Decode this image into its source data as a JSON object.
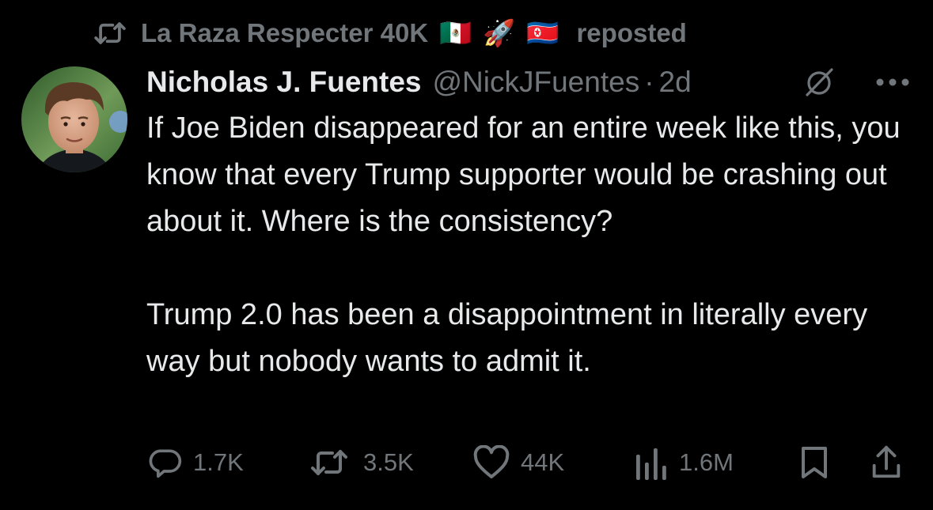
{
  "repost": {
    "reposter_name": "La Raza Respecter 40K",
    "emojis": [
      "🇲🇽",
      "🚀",
      "🇰🇵"
    ],
    "suffix": "reposted"
  },
  "author": {
    "display_name": "Nicholas J. Fuentes",
    "handle": "@NickJFuentes",
    "separator": "·",
    "time": "2d"
  },
  "tweet": {
    "paragraphs": [
      "If Joe Biden disappeared for an entire week like this, you know that every Trump supporter would be crashing out about it. Where is the consistency?",
      "Trump 2.0 has been a disappointment in literally every way but nobody wants to admit it."
    ]
  },
  "actions": {
    "replies": "1.7K",
    "reposts": "3.5K",
    "likes": "44K",
    "views": "1.6M"
  },
  "icons": {
    "repost": "repost-icon",
    "grok": "grok-icon",
    "more": "more-icon",
    "reply": "reply-icon",
    "like": "heart-icon",
    "views": "views-icon",
    "bookmark": "bookmark-icon",
    "share": "share-icon"
  },
  "colors": {
    "background": "#000000",
    "primary_text": "#e7e9ea",
    "secondary_text": "#71767b"
  }
}
